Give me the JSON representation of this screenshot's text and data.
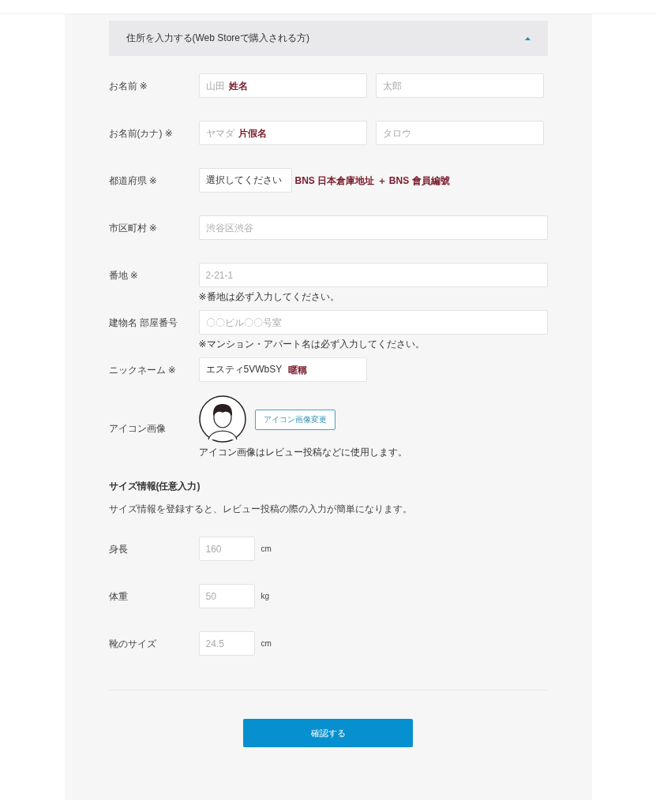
{
  "section": {
    "title": "住所を入力する(Web Storeで購入される方)",
    "expanded": true
  },
  "fields": [
    {
      "label": "お名前 ※",
      "kind": "pair",
      "inputs": [
        {
          "placeholder": "山田",
          "annotation": "姓名"
        },
        {
          "placeholder": "太郎"
        }
      ]
    },
    {
      "label": "お名前(カナ) ※",
      "kind": "pair",
      "inputs": [
        {
          "placeholder": "ヤマダ",
          "annotation": "片假名"
        },
        {
          "placeholder": "タロウ"
        }
      ]
    },
    {
      "label": "都道府県 ※",
      "kind": "select",
      "inputs": [
        {
          "value": "選択してください",
          "annotation": "BNS 日本倉庫地址 ＋ BNS 會員編號"
        }
      ]
    },
    {
      "label": "市区町村 ※",
      "kind": "wide",
      "inputs": [
        {
          "placeholder": "渋谷区渋谷"
        }
      ]
    },
    {
      "label": "番地 ※",
      "kind": "wide",
      "inputs": [
        {
          "placeholder": "2-21-1"
        }
      ],
      "note": "※番地は必ず入力してください。"
    },
    {
      "label": "建物名 部屋番号",
      "kind": "wide",
      "inputs": [
        {
          "placeholder": "〇〇ビル〇〇号室"
        }
      ],
      "note": "※マンション・アパート名は必ず入力してください。"
    },
    {
      "label": "ニックネーム ※",
      "kind": "half",
      "inputs": [
        {
          "value": "エスティ5VWbSY",
          "annotation": "暱稱"
        }
      ]
    }
  ],
  "avatar": {
    "label": "アイコン画像",
    "button": "アイコン画像変更",
    "note": "アイコン画像はレビュー投稿などに使用します。"
  },
  "size": {
    "heading": "サイズ情報(任意入力)",
    "description": "サイズ情報を登録すると、レビュー投稿の際の入力が簡単になります。",
    "measurements": [
      {
        "label": "身長",
        "placeholder": "160",
        "unit": "cm"
      },
      {
        "label": "体重",
        "placeholder": "50",
        "unit": "kg"
      },
      {
        "label": "靴のサイズ",
        "placeholder": "24.5",
        "unit": "cm"
      }
    ]
  },
  "submit": "確認する"
}
